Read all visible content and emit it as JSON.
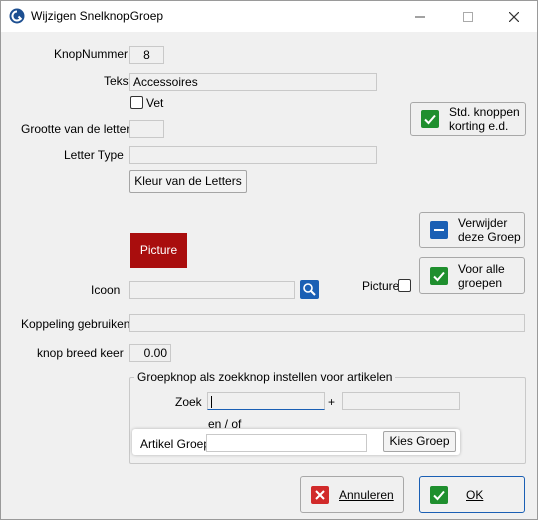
{
  "window": {
    "title": "Wijzigen SnelknopGroep",
    "minimize_icon": "minimize-icon",
    "maximize_icon": "maximize-icon",
    "close_icon": "close-icon"
  },
  "form": {
    "knopnummer_label": "KnopNummer",
    "knopnummer_value": "8",
    "tekst_label": "Tekst",
    "tekst_value": "Accessoires",
    "vet_label": "Vet",
    "grootte_label": "Grootte van de letter",
    "grootte_value": "",
    "lettertype_label": "Letter Type",
    "lettertype_value": "",
    "kleur_button": "Kleur van de Letters",
    "picture_preview": "Picture",
    "icoon_label": "Icoon",
    "icoon_value": "",
    "picture_check_label": "Picture",
    "koppeling_label": "Koppeling gebruiken",
    "koppeling_value": "",
    "breed_label": "knop breed keer",
    "breed_value": "0.00"
  },
  "side_buttons": {
    "std_knoppen": "Std. knoppen\nkorting e.d.",
    "verwijder": "Verwijder\ndeze Groep",
    "voor_alle": "Voor alle\ngroepen"
  },
  "group": {
    "title": "Groepknop als zoekknop instellen voor artikelen",
    "zoek_label": "Zoek",
    "zoek_value": "",
    "plus": "+",
    "zoek2_value": "",
    "en_of": "en / of",
    "artikel_label": "Artikel Groep",
    "artikel_value": "",
    "kies_button": "Kies Groep"
  },
  "footer": {
    "annuleren": "Annuleren",
    "ok": "OK"
  },
  "colors": {
    "picture_bg": "#a90d0d",
    "accent_blue": "#1a5fb4",
    "check_green": "#1f8f2e",
    "cancel_red": "#d12a2a"
  }
}
